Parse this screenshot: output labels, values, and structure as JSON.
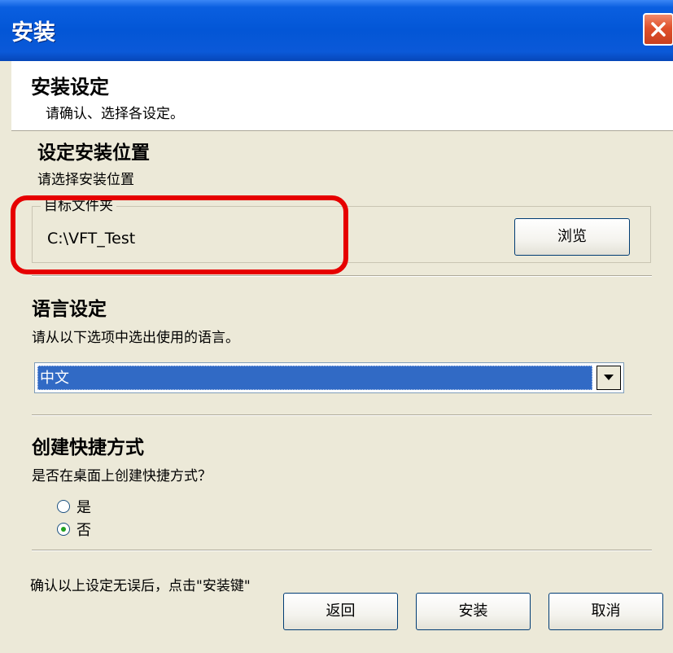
{
  "window": {
    "title": "安装"
  },
  "header": {
    "title": "安装设定",
    "subtitle": "请确认、选择各设定。"
  },
  "location": {
    "title": "设定安装位置",
    "instruction": "请选择安装位置",
    "group_label": "目标文件夹",
    "path": "C:\\VFT_Test",
    "browse_label": "浏览"
  },
  "language": {
    "title": "语言设定",
    "instruction": "请从以下选项中选出使用的语言。",
    "selected": "中文"
  },
  "shortcut": {
    "title": "创建快捷方式",
    "question": "是否在桌面上创建快捷方式？",
    "options": [
      {
        "label": "是",
        "checked": false
      },
      {
        "label": "否",
        "checked": true
      }
    ]
  },
  "footer": {
    "note": "确认以上设定无误后，点击\"安装键\"",
    "back_label": "返回",
    "install_label": "安装",
    "cancel_label": "取消"
  },
  "colors": {
    "titlebar": "#0356d6",
    "dialog_bg": "#ece9d8",
    "selection": "#316ac5",
    "highlight": "#e60000",
    "close": "#e0512c"
  },
  "icons": {
    "close": "close-icon",
    "dropdown": "chevron-down-icon",
    "radio_checked": "radio-checked-icon",
    "radio_unchecked": "radio-unchecked-icon"
  }
}
